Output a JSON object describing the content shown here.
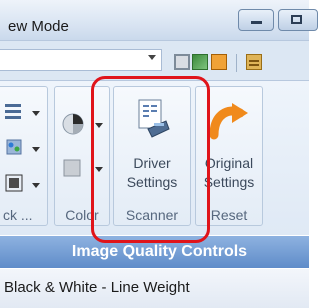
{
  "window": {
    "title": "ew Mode",
    "minimize_icon": "minimize-icon",
    "maximize_icon": "maximize-icon"
  },
  "toolbar": {
    "icons": [
      "scan-icon",
      "image-icon",
      "film-icon",
      "settings-strip-icon"
    ]
  },
  "ribbon": {
    "groups": [
      {
        "label": "ck ...",
        "icons": [
          "list-icon",
          "palette-icon",
          "frame-icon"
        ]
      },
      {
        "label": "Color",
        "icons": [
          "color-wheel-icon",
          "gray-swatch-icon"
        ]
      },
      {
        "label": "Scanner",
        "buttons": [
          {
            "line1": "Driver",
            "line2": "Settings",
            "icon": "scanner-driver-icon"
          }
        ]
      },
      {
        "label": "Reset",
        "buttons": [
          {
            "line1": "Original",
            "line2": "Settings",
            "icon": "undo-arrow-icon"
          }
        ]
      }
    ]
  },
  "band": {
    "title": "Image Quality Controls"
  },
  "bottom": {
    "label": "Black & White - Line Weight"
  },
  "colors": {
    "highlight": "#e0141a",
    "band": "#6f99d2",
    "undo_arrow": "#f08a1c"
  }
}
